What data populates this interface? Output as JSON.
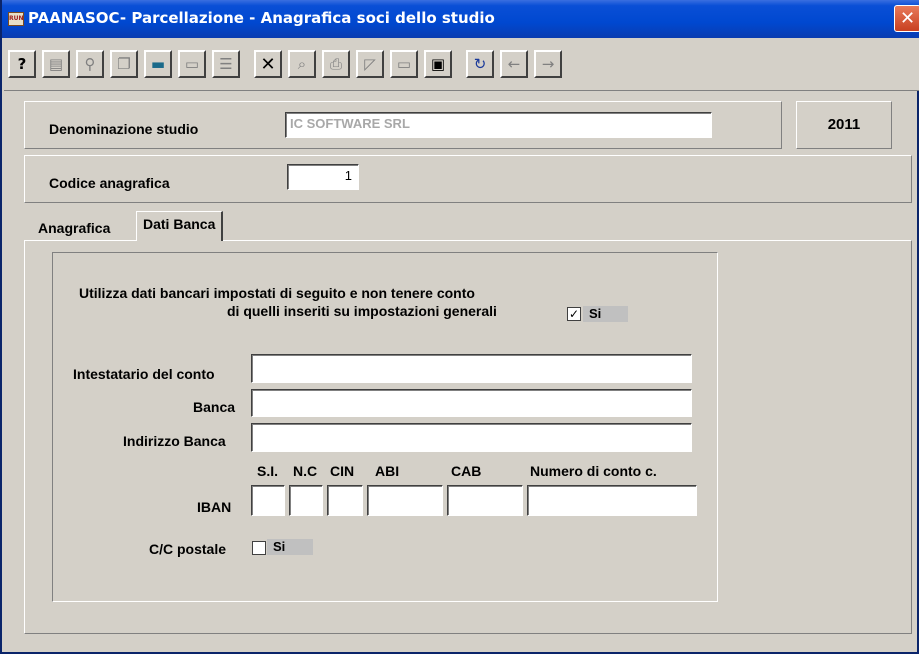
{
  "window": {
    "title": "PAANASOC- Parcellazione - Anagrafica soci dello studio",
    "app_icon_text": "RUN",
    "close_glyph": "✕"
  },
  "toolbar": {
    "buttons": [
      {
        "name": "help-icon",
        "glyph": "?",
        "active": true
      },
      {
        "name": "properties-icon",
        "glyph": "▤",
        "active": false
      },
      {
        "name": "binoculars-icon",
        "glyph": "⚲",
        "active": false
      },
      {
        "name": "copy-icon",
        "glyph": "❐",
        "active": false
      },
      {
        "name": "calculator-icon",
        "glyph": "▬",
        "active": true
      },
      {
        "name": "paste-icon",
        "glyph": "▭",
        "active": false
      },
      {
        "name": "list-icon",
        "glyph": "☰",
        "active": false
      },
      {
        "name": "delete-icon",
        "glyph": "✕",
        "active": true
      },
      {
        "name": "preview-icon",
        "glyph": "⌕",
        "active": false
      },
      {
        "name": "print-icon",
        "glyph": "⎙",
        "active": false
      },
      {
        "name": "chart-icon",
        "glyph": "◸",
        "active": false
      },
      {
        "name": "form-icon",
        "glyph": "▭",
        "active": false
      },
      {
        "name": "save-icon",
        "glyph": "▣",
        "active": true
      },
      {
        "name": "refresh-icon",
        "glyph": "↻",
        "active": true
      },
      {
        "name": "arrow-left-icon",
        "glyph": "←",
        "active": false
      },
      {
        "name": "arrow-right-icon",
        "glyph": "→",
        "active": false
      }
    ]
  },
  "header": {
    "studio_label": "Denominazione studio",
    "studio_value": "IC SOFTWARE SRL",
    "year": "2011",
    "codice_label": "Codice anagrafica",
    "codice_value": "1"
  },
  "tabs": {
    "anagrafica": "Anagrafica",
    "dati_banca": "Dati Banca"
  },
  "dati_banca": {
    "note_line1": "Utilizza dati bancari impostati di seguito e non tenere conto",
    "note_line2": "di quelli inseriti su impostazioni generali",
    "use_checked": "✓",
    "use_label": "Si",
    "intestatario_label": "Intestatario del conto",
    "intestatario_value": "",
    "banca_label": "Banca",
    "banca_value": "",
    "indirizzo_label": "Indirizzo Banca",
    "indirizzo_value": "",
    "iban_headers": {
      "si": "S.I.",
      "nc": "N.C",
      "cin": "CIN",
      "abi": "ABI",
      "cab": "CAB",
      "conto": "Numero di conto c."
    },
    "iban_label": "IBAN",
    "postale_label": "C/C postale",
    "postale_checked": "",
    "postale_si": "Si"
  }
}
